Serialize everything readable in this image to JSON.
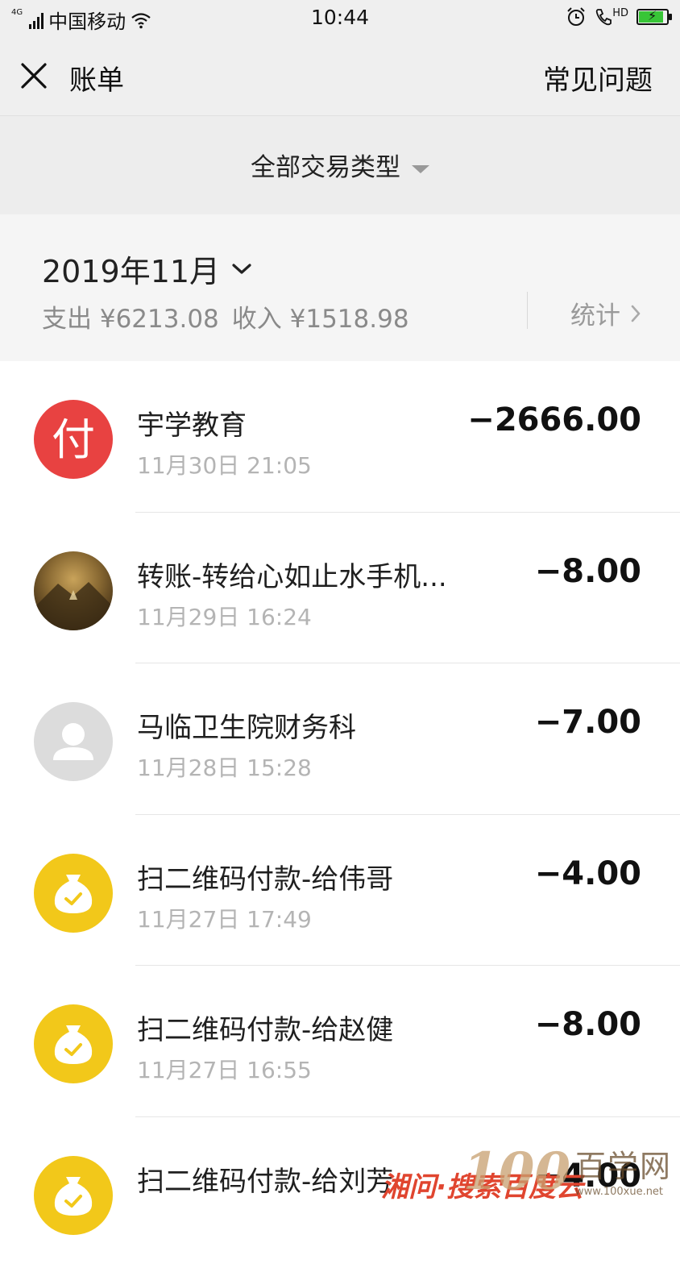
{
  "status_bar": {
    "network": "4G",
    "carrier": "中国移动",
    "time": "10:44",
    "call_label": "HD"
  },
  "nav": {
    "title": "账单",
    "faq": "常见问题"
  },
  "filter": {
    "label": "全部交易类型"
  },
  "month": {
    "title": "2019年11月",
    "expense": "支出 ¥6213.08",
    "income": "收入 ¥1518.98",
    "stats": "统计"
  },
  "transactions": [
    {
      "name": "宇学教育",
      "time": "11月30日 21:05",
      "amount": "−2666.00",
      "avatar": "red-pay-logo",
      "avatar_glyph": "付"
    },
    {
      "name": "转账-转给心如止水手机...",
      "time": "11月29日 16:24",
      "amount": "−8.00",
      "avatar": "photo-avatar"
    },
    {
      "name": "马临卫生院财务科",
      "time": "11月28日 15:28",
      "amount": "−7.00",
      "avatar": "default-person-avatar"
    },
    {
      "name": "扫二维码付款-给伟哥",
      "time": "11月27日 17:49",
      "amount": "−4.00",
      "avatar": "money-bag-icon"
    },
    {
      "name": "扫二维码付款-给赵健",
      "time": "11月27日 16:55",
      "amount": "−8.00",
      "avatar": "money-bag-icon"
    },
    {
      "name": "扫二维码付款-给刘芳",
      "time": "",
      "amount": "−4.00",
      "avatar": "money-bag-icon"
    }
  ],
  "watermark": {
    "number": "100",
    "site_cn": "百学网",
    "url": "www.100xue.net",
    "slogan": "湘问·搜索百度云"
  },
  "colors": {
    "accent_red": "#e84241",
    "wechat_yellow": "#f2c81a",
    "battery_green": "#38c537"
  }
}
